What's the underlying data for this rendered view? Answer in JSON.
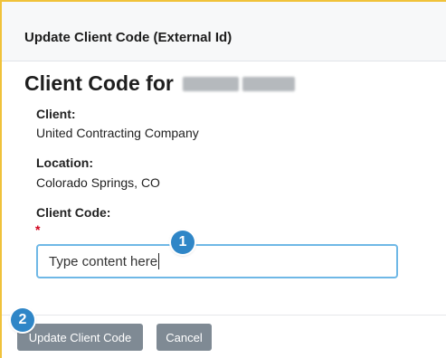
{
  "dialog": {
    "title": "Update Client Code (External Id)"
  },
  "section": {
    "heading": "Client Code for"
  },
  "fields": {
    "client_label": "Client:",
    "client_value": "United Contracting Company",
    "location_label": "Location:",
    "location_value": "Colorado Springs, CO",
    "client_code_label": "Client Code:",
    "required_marker": "*",
    "client_code_placeholder": "Type content here"
  },
  "buttons": {
    "update_label": "Update Client Code",
    "cancel_label": "Cancel"
  },
  "annotations": {
    "step_1": "1",
    "step_2": "2"
  },
  "colors": {
    "accent_border": "#f0c23a",
    "input_focus": "#6fb8e6",
    "button_bg": "#7f8a94",
    "badge_bg": "#2f86c7",
    "required": "#d0021b"
  }
}
